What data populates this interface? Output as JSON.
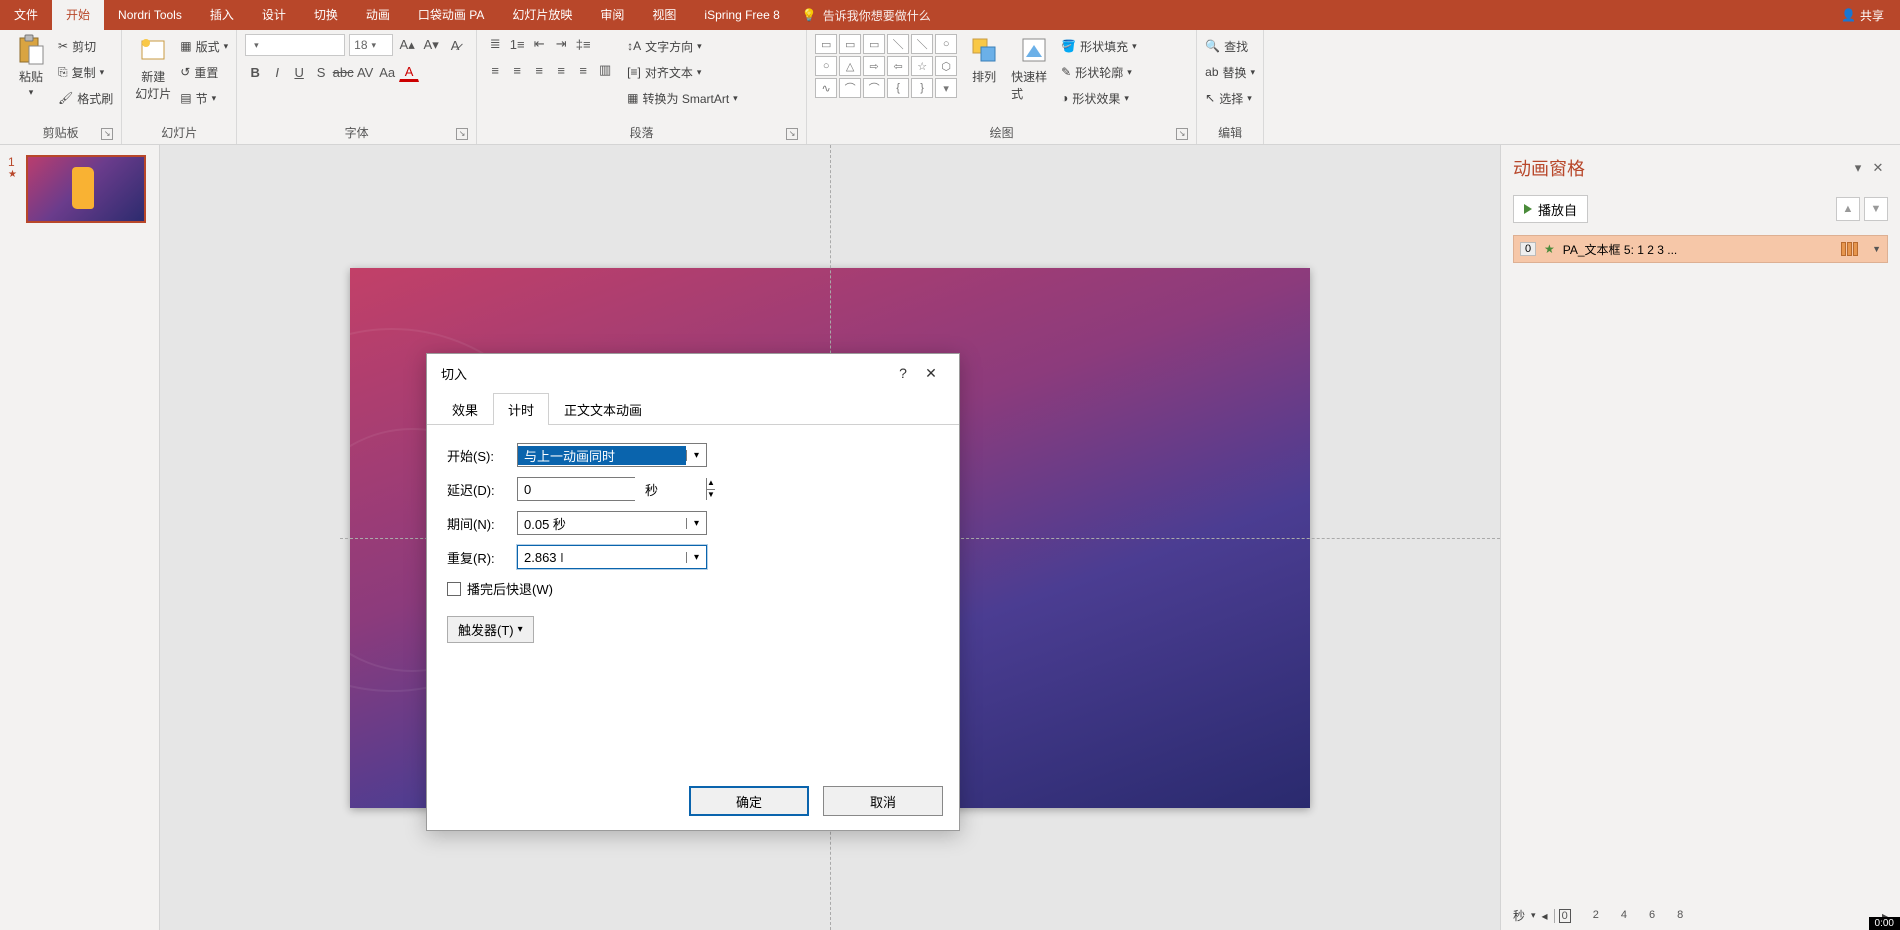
{
  "titlebar": {
    "tabs": [
      "文件",
      "开始",
      "Nordri Tools",
      "插入",
      "设计",
      "切换",
      "动画",
      "口袋动画 PA",
      "幻灯片放映",
      "审阅",
      "视图",
      "iSpring Free 8"
    ],
    "active_index": 1,
    "tellme": "告诉我你想要做什么",
    "share": "共享"
  },
  "ribbon": {
    "clipboard": {
      "label": "剪贴板",
      "paste": "粘贴",
      "cut": "剪切",
      "copy": "复制",
      "format_painter": "格式刷"
    },
    "slides": {
      "label": "幻灯片",
      "new_slide": "新建\n幻灯片",
      "layout": "版式",
      "reset": "重置",
      "section": "节"
    },
    "font": {
      "label": "字体",
      "size": "18"
    },
    "paragraph": {
      "label": "段落",
      "text_direction": "文字方向",
      "align_text": "对齐文本",
      "convert_smartart": "转换为 SmartArt"
    },
    "drawing": {
      "label": "绘图",
      "arrange": "排列",
      "quick_styles": "快速样式",
      "shape_fill": "形状填充",
      "shape_outline": "形状轮廓",
      "shape_effects": "形状效果"
    },
    "editing": {
      "label": "编辑",
      "find": "查找",
      "replace": "替换",
      "select": "选择"
    }
  },
  "thumb": {
    "index": "1"
  },
  "dialog": {
    "title": "切入",
    "tabs": {
      "effect": "效果",
      "timing": "计时",
      "text_anim": "正文文本动画"
    },
    "start_label": "开始(S):",
    "start_value": "与上一动画同时",
    "delay_label": "延迟(D):",
    "delay_value": "0",
    "delay_unit": "秒",
    "duration_label": "期间(N):",
    "duration_value": "0.05 秒",
    "repeat_label": "重复(R):",
    "repeat_value": "2.863",
    "rewind_label": "播完后快退(W)",
    "trigger": "触发器(T)",
    "ok": "确定",
    "cancel": "取消"
  },
  "anim_pane": {
    "title": "动画窗格",
    "play_from": "播放自",
    "item": {
      "index": "0",
      "name": "PA_文本框 5: 1 2 3 ..."
    },
    "seconds": "秒",
    "ruler": [
      "0",
      "2",
      "4",
      "6",
      "8"
    ]
  },
  "status": {
    "time": "0:00"
  }
}
